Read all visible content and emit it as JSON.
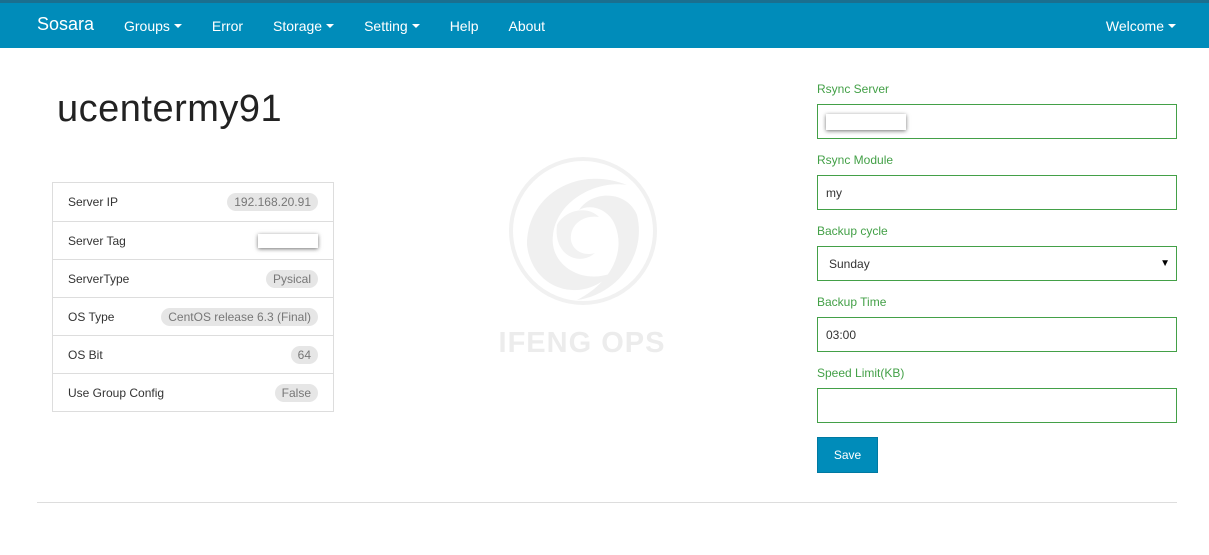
{
  "app": {
    "brand": "Sosara"
  },
  "nav": [
    {
      "label": "Groups",
      "dropdown": true
    },
    {
      "label": "Error",
      "dropdown": false
    },
    {
      "label": "Storage",
      "dropdown": true
    },
    {
      "label": "Setting",
      "dropdown": true
    },
    {
      "label": "Help",
      "dropdown": false
    },
    {
      "label": "About",
      "dropdown": false
    }
  ],
  "user_menu": {
    "label": "Welcome"
  },
  "page": {
    "title": "ucentermy91"
  },
  "server_info": {
    "rows": [
      {
        "label": "Server IP",
        "value": "192.168.20.91"
      },
      {
        "label": "Server Tag",
        "value": ""
      },
      {
        "label": "ServerType",
        "value": "Pysical"
      },
      {
        "label": "OS Type",
        "value": "CentOS release 6.3 (Final)"
      },
      {
        "label": "OS Bit",
        "value": "64"
      },
      {
        "label": "Use Group Config",
        "value": "False"
      }
    ]
  },
  "watermark": {
    "text": "IFENG OPS"
  },
  "form": {
    "rsync_server": {
      "label": "Rsync Server",
      "value": ""
    },
    "rsync_module": {
      "label": "Rsync Module",
      "value": "my"
    },
    "backup_cycle": {
      "label": "Backup cycle",
      "value": "Sunday"
    },
    "backup_time": {
      "label": "Backup Time",
      "value": "03:00"
    },
    "speed_limit": {
      "label": "Speed Limit(KB)",
      "value": ""
    },
    "save_label": "Save"
  },
  "colors": {
    "navbar": "#008cba",
    "accent_green": "#43a047"
  }
}
